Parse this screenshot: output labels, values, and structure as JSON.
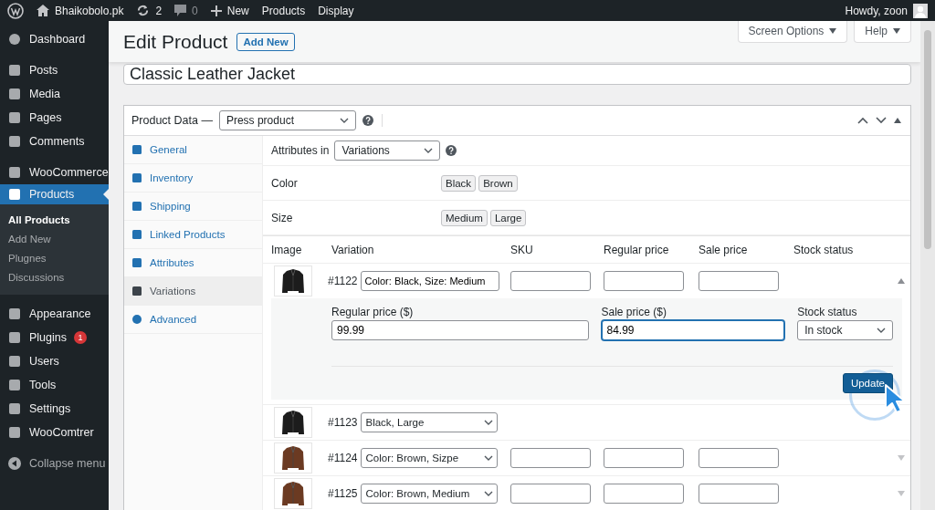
{
  "admin_bar": {
    "site": "Bhaikobolo.pk",
    "updates": "2",
    "comments": "0",
    "new": "New",
    "links": [
      "Products",
      "Display"
    ],
    "greeting": "Howdy, zoon"
  },
  "sidebar": {
    "groups": [
      [
        {
          "label": "Dashboard",
          "selected": false
        }
      ],
      [
        {
          "label": "Posts",
          "selected": false
        },
        {
          "label": "Media",
          "selected": false
        },
        {
          "label": "Pages",
          "selected": false
        },
        {
          "label": "Comments",
          "selected": false
        }
      ],
      [
        {
          "label": "WooCommerce",
          "selected": false
        },
        {
          "label": "Products",
          "selected": true,
          "submenu": [
            {
              "label": "All Products",
              "selected": true
            },
            {
              "label": "Add New",
              "selected": false
            },
            {
              "label": "Plugnes",
              "selected": false
            },
            {
              "label": "Discussions",
              "selected": false
            }
          ]
        }
      ],
      [
        {
          "label": "Appearance",
          "selected": false
        },
        {
          "label": "Plugins",
          "selected": false,
          "badge": "1"
        },
        {
          "label": "Users",
          "selected": false
        },
        {
          "label": "Tools",
          "selected": false
        },
        {
          "label": "Settings",
          "selected": false
        },
        {
          "label": "WooComtrer",
          "selected": false
        }
      ]
    ],
    "collapse": "Collapse menu"
  },
  "header": {
    "title": "Edit Product",
    "add_new": "Add New",
    "screen_options": "Screen Options",
    "help": "Help"
  },
  "product_title": "Classic Leather Jacket",
  "product_data": {
    "label": "Product Data —",
    "type": "Press product",
    "tabs": [
      {
        "label": "General",
        "selected": false
      },
      {
        "label": "Inventory",
        "selected": false
      },
      {
        "label": "Shipping",
        "selected": false
      },
      {
        "label": "Linked Products",
        "selected": false
      },
      {
        "label": "Attributes",
        "selected": false
      },
      {
        "label": "Variations",
        "selected": true
      },
      {
        "label": "Advanced",
        "selected": false
      }
    ],
    "attributes_in": {
      "label": "Attributes in",
      "value": "Variations"
    },
    "attributes": [
      {
        "name": "Color",
        "values": [
          "Black",
          "Brown"
        ]
      },
      {
        "name": "Size",
        "values": [
          "Medium",
          "Large"
        ]
      }
    ],
    "columns": [
      "Image",
      "Variation",
      "SKU",
      "Regular price",
      "Sale price",
      "Stock status"
    ],
    "variations": [
      {
        "id": "#1122",
        "kind": "input",
        "name": "Color: Black, Size: Medium",
        "color": "#1c1c1c",
        "price_fields": true,
        "expanded": true,
        "details": {
          "regular_label": "Regular price ($)",
          "regular": "99.99",
          "sale_label": "Sale price ($)",
          "sale": "84.99",
          "sale_focused": true,
          "stock_label": "Stock status",
          "stock": "In stock",
          "update": "Update"
        }
      },
      {
        "id": "#1123",
        "kind": "select",
        "name": "Black, Large",
        "color": "#1c1c1c",
        "price_fields": false,
        "expanded": false
      },
      {
        "id": "#1124",
        "kind": "select",
        "name": "Color: Brown, Sizpe",
        "color": "#6b3a22",
        "price_fields": true,
        "expanded": false
      },
      {
        "id": "#1125",
        "kind": "select",
        "name": "Color: Brown, Medium",
        "color": "#6b3a22",
        "price_fields": true,
        "expanded": false
      }
    ]
  }
}
